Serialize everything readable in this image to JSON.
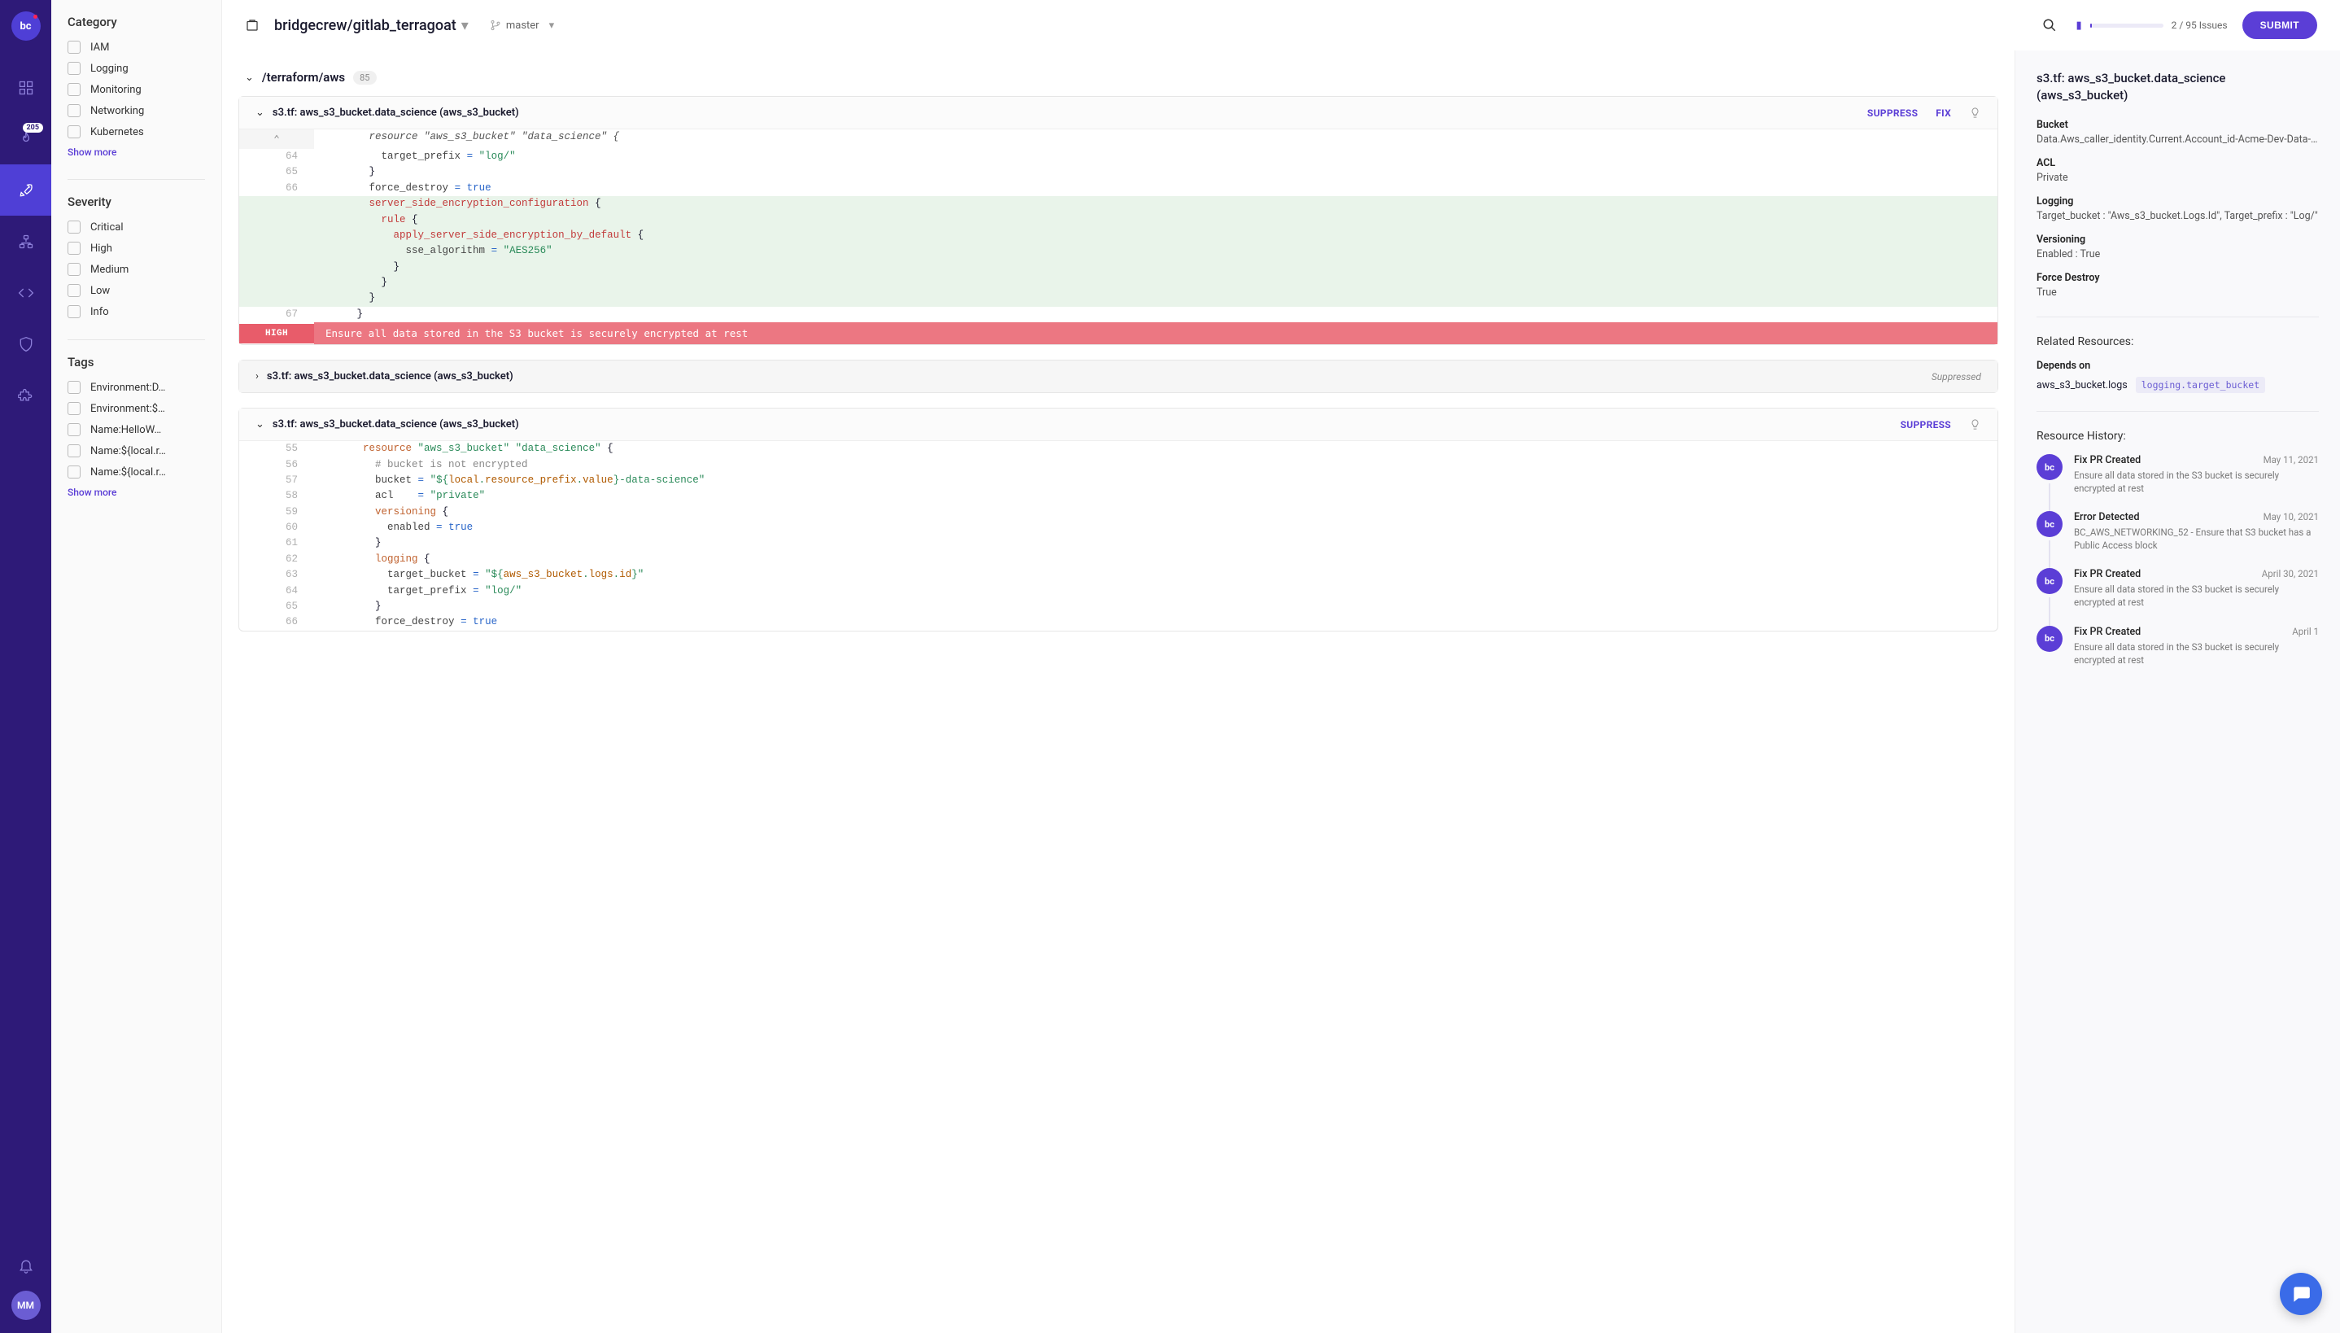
{
  "nav": {
    "logo_text": "bc",
    "badge": "205",
    "avatar": "MM"
  },
  "filters": {
    "category": {
      "title": "Category",
      "items": [
        "IAM",
        "Logging",
        "Monitoring",
        "Networking",
        "Kubernetes"
      ],
      "show_more": "Show more"
    },
    "severity": {
      "title": "Severity",
      "items": [
        "Critical",
        "High",
        "Medium",
        "Low",
        "Info"
      ]
    },
    "tags": {
      "title": "Tags",
      "items": [
        "Environment:D…",
        "Environment:$…",
        "Name:HelloW…",
        "Name:${local.r…",
        "Name:${local.r…"
      ],
      "show_more": "Show more"
    }
  },
  "topbar": {
    "repo": "bridgecrew/gitlab_terragoat",
    "branch": "master",
    "issues": "2 / 95 Issues",
    "submit": "SUBMIT"
  },
  "path": {
    "text": "/terraform/aws",
    "count": "85"
  },
  "card1": {
    "title": "s3.tf: aws_s3_bucket.data_science (aws_s3_bucket)",
    "suppress": "SUPPRESS",
    "fix": "FIX",
    "lines": {
      "l0": "         resource \"aws_s3_bucket\" \"data_science\" {",
      "g1": "64",
      "l1": "           target_prefix = \"log/\"",
      "g2": "65",
      "l2": "         }",
      "g3": "66",
      "l3": "         force_destroy = true",
      "a1": "         server_side_encryption_configuration {",
      "a2": "           rule {",
      "a3": "             apply_server_side_encryption_by_default {",
      "a4": "               sse_algorithm = \"AES256\"",
      "a5": "             }",
      "a6": "           }",
      "a7": "         }",
      "g4": "67",
      "l4": "       }"
    },
    "severity": "HIGH",
    "message": "Ensure all data stored in the S3 bucket is securely encrypted at rest"
  },
  "card2": {
    "title": "s3.tf: aws_s3_bucket.data_science (aws_s3_bucket)",
    "suppressed": "Suppressed"
  },
  "card3": {
    "title": "s3.tf: aws_s3_bucket.data_science (aws_s3_bucket)",
    "suppress": "SUPPRESS",
    "lines": {
      "g1": "55",
      "g2": "56",
      "g3": "57",
      "g4": "58",
      "g5": "59",
      "g6": "60",
      "g7": "61",
      "g8": "62",
      "g9": "63",
      "g10": "64",
      "g11": "65",
      "g12": "66"
    },
    "l1": "        resource \"aws_s3_bucket\" \"data_science\" {",
    "l2": "          # bucket is not encrypted",
    "l3_a": "          bucket = ",
    "l3_b": "\"${",
    "l3_c": "local",
    "l3_d": ".",
    "l3_e": "resource_prefix",
    "l3_f": ".",
    "l3_g": "value",
    "l3_h": "}-data-science\"",
    "l4": "          acl    = \"private\"",
    "l5": "          versioning {",
    "l6": "            enabled = true",
    "l7": "          }",
    "l8": "          logging {",
    "l9_a": "            target_bucket = ",
    "l9_b": "\"${",
    "l9_c": "aws_s3_bucket",
    "l9_d": ".",
    "l9_e": "logs",
    "l9_f": ".",
    "l9_g": "id",
    "l9_h": "}\"",
    "l10": "            target_prefix = \"log/\"",
    "l11": "          }",
    "l12": "          force_destroy = true"
  },
  "details": {
    "title": "s3.tf: aws_s3_bucket.data_science (aws_s3_bucket)",
    "bucket_label": "Bucket",
    "bucket_value": "Data.Aws_caller_identity.Current.Account_id-Acme-Dev-Data-Sci…",
    "acl_label": "ACL",
    "acl_value": "Private",
    "logging_label": "Logging",
    "logging_value": "Target_bucket : \"Aws_s3_bucket.Logs.Id\", Target_prefix : \"Log/\"",
    "versioning_label": "Versioning",
    "versioning_value": "Enabled : True",
    "fd_label": "Force Destroy",
    "fd_value": "True",
    "related_title": "Related Resources:",
    "depends_label": "Depends on",
    "depends_res": "aws_s3_bucket.logs",
    "depends_target": "logging.target_bucket",
    "history_title": "Resource History:",
    "h1_title": "Fix PR Created",
    "h1_date": "May 11, 2021",
    "h1_desc": "Ensure all data stored in the S3 bucket is securely encrypted at rest",
    "h2_title": "Error Detected",
    "h2_date": "May 10, 2021",
    "h2_desc": "BC_AWS_NETWORKING_52 - Ensure that S3 bucket has a Public Access block",
    "h3_title": "Fix PR Created",
    "h3_date": "April 30, 2021",
    "h3_desc": "Ensure all data stored in the S3 bucket is securely encrypted at rest",
    "h4_title": "Fix PR Created",
    "h4_date": "April 1",
    "h4_desc": "Ensure all data stored in the S3 bucket is securely encrypted at rest"
  }
}
